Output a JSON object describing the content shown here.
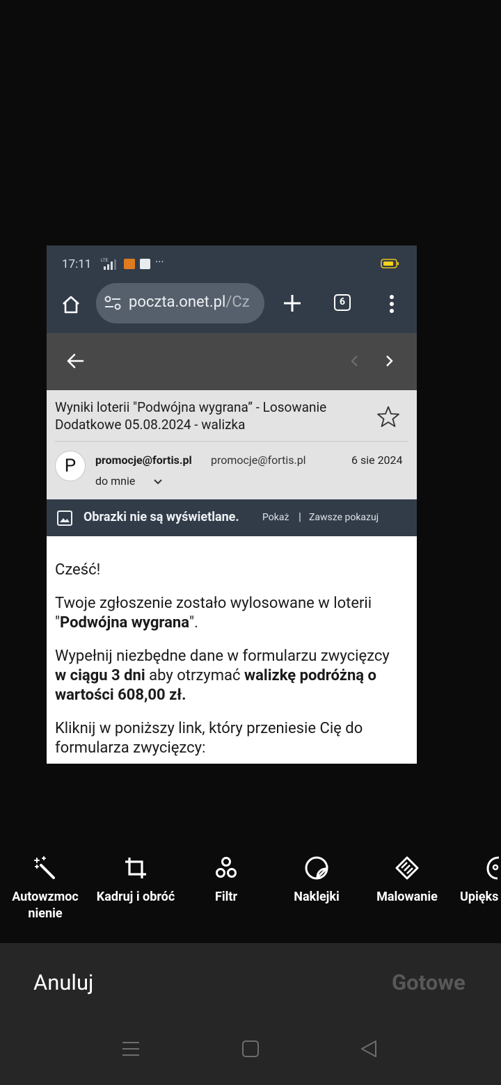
{
  "screenshot": {
    "status_bar": {
      "time": "17:11",
      "more": "···",
      "lte": "LTE"
    },
    "browser": {
      "url_host": "poczta.onet.pl",
      "url_path": "/Cz",
      "tab_count": "6"
    },
    "email": {
      "subject": "Wyniki loterii \"Podwójna wygrana” - Losowanie Dodatkowe 05.08.2024 - walizka",
      "avatar_letter": "P",
      "sender_name": "promocje@fortis.pl",
      "sender_email": "promocje@fortis.pl",
      "date": "6 sie 2024",
      "to": "do mnie",
      "images_notice": "Obrazki nie są wyświetlane.",
      "show_label": "Pokaż",
      "separator": "|",
      "always_show_label": "Zawsze pokazuj",
      "greeting": "Cześć!",
      "p1_a": "Twoje zgłoszenie zostało wylosowane w loterii \"",
      "p1_b": "Podwójna wygrana",
      "p1_c": "\".",
      "p2_a": "Wypełnij niezbędne dane w formularzu zwycięzcy ",
      "p2_b": "w ciągu 3 dni",
      "p2_c": " aby otrzymać ",
      "p2_d": "walizkę podróżną o wartości 608,00 zł.",
      "p3": "Kliknij w poniższy link, który przeniesie Cię do formularza zwycięzcy:"
    }
  },
  "editor": {
    "tools": [
      {
        "label": "Autowzmoc nienie",
        "icon": "magic-wand-icon"
      },
      {
        "label": "Kadruj i obróć",
        "icon": "crop-icon"
      },
      {
        "label": "Filtr",
        "icon": "filter-icon"
      },
      {
        "label": "Naklejki",
        "icon": "sticker-icon"
      },
      {
        "label": "Malowanie",
        "icon": "eraser-icon"
      },
      {
        "label": "Upięks",
        "icon": "beauty-icon"
      }
    ],
    "cancel_label": "Anuluj",
    "done_label": "Gotowe"
  }
}
